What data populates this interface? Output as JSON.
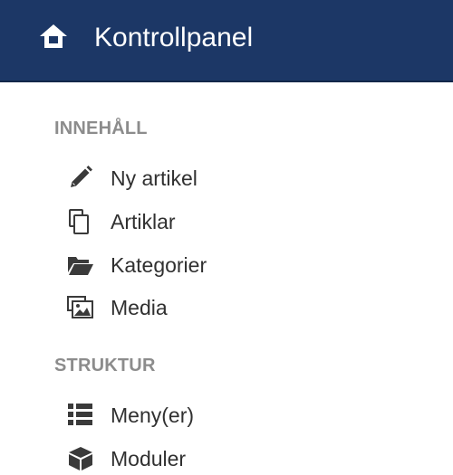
{
  "header": {
    "title": "Kontrollpanel",
    "icon": "home-icon"
  },
  "sections": [
    {
      "heading": "INNEHÅLL",
      "items": [
        {
          "label": "Ny artikel",
          "icon": "pencil-icon"
        },
        {
          "label": "Artiklar",
          "icon": "copy-icon"
        },
        {
          "label": "Kategorier",
          "icon": "folder-open-icon"
        },
        {
          "label": "Media",
          "icon": "image-icon"
        }
      ]
    },
    {
      "heading": "STRUKTUR",
      "items": [
        {
          "label": "Meny(er)",
          "icon": "list-icon"
        },
        {
          "label": "Moduler",
          "icon": "cube-icon"
        }
      ]
    }
  ],
  "colors": {
    "header_bg": "#1c3766",
    "icon": "#3a3a3a",
    "text": "#303030",
    "heading": "#8c8c8c"
  }
}
